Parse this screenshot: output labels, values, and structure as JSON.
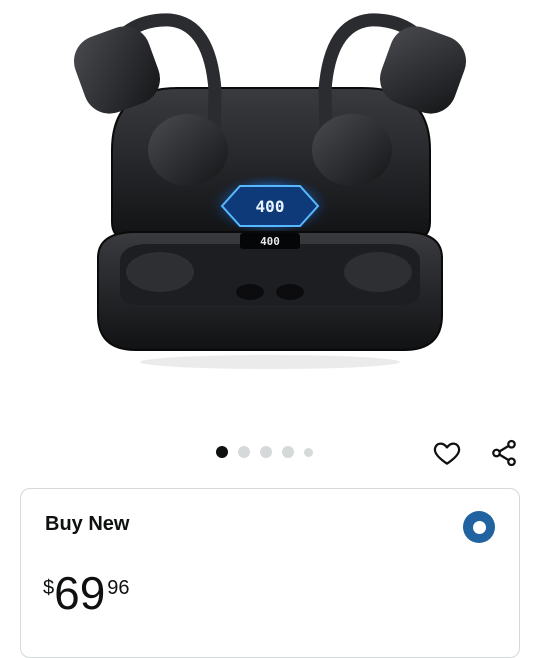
{
  "product": {
    "display_readout_large": "400",
    "display_readout_small": "400"
  },
  "carousel": {
    "count": 5,
    "active_index": 0
  },
  "actions": {
    "wishlist_icon": "heart-icon",
    "share_icon": "share-icon"
  },
  "buy_card": {
    "title": "Buy New",
    "selected": true,
    "price": {
      "symbol": "$",
      "whole": "69",
      "fraction": "96"
    }
  },
  "colors": {
    "accent": "#2162a1",
    "text": "#0f1111",
    "border": "#d5d9d9",
    "display_glow": "#1e90ff"
  }
}
